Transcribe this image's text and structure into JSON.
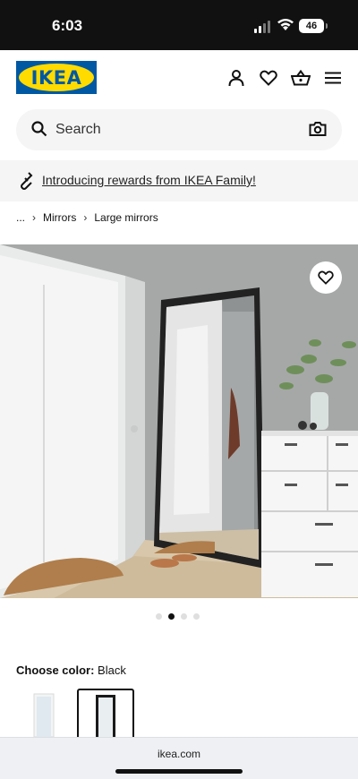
{
  "status_bar": {
    "time": "6:03",
    "battery": "46"
  },
  "header": {
    "logo_text": "IKEA",
    "icons": [
      "account-icon",
      "heart-icon",
      "basket-icon",
      "menu-icon"
    ]
  },
  "search": {
    "placeholder": "Search"
  },
  "promo": {
    "text": "Introducing rewards from IKEA Family!"
  },
  "breadcrumb": {
    "ellipsis": "...",
    "items": [
      "Mirrors",
      "Large mirrors"
    ]
  },
  "carousel": {
    "total": 4,
    "active_index": 1
  },
  "color": {
    "label": "Choose color:",
    "value": "Black",
    "swatches": [
      "White",
      "Black"
    ],
    "selected": 1
  },
  "browser": {
    "url": "ikea.com"
  },
  "colors": {
    "ikea_blue": "#0058a3",
    "ikea_yellow": "#ffdb00"
  }
}
